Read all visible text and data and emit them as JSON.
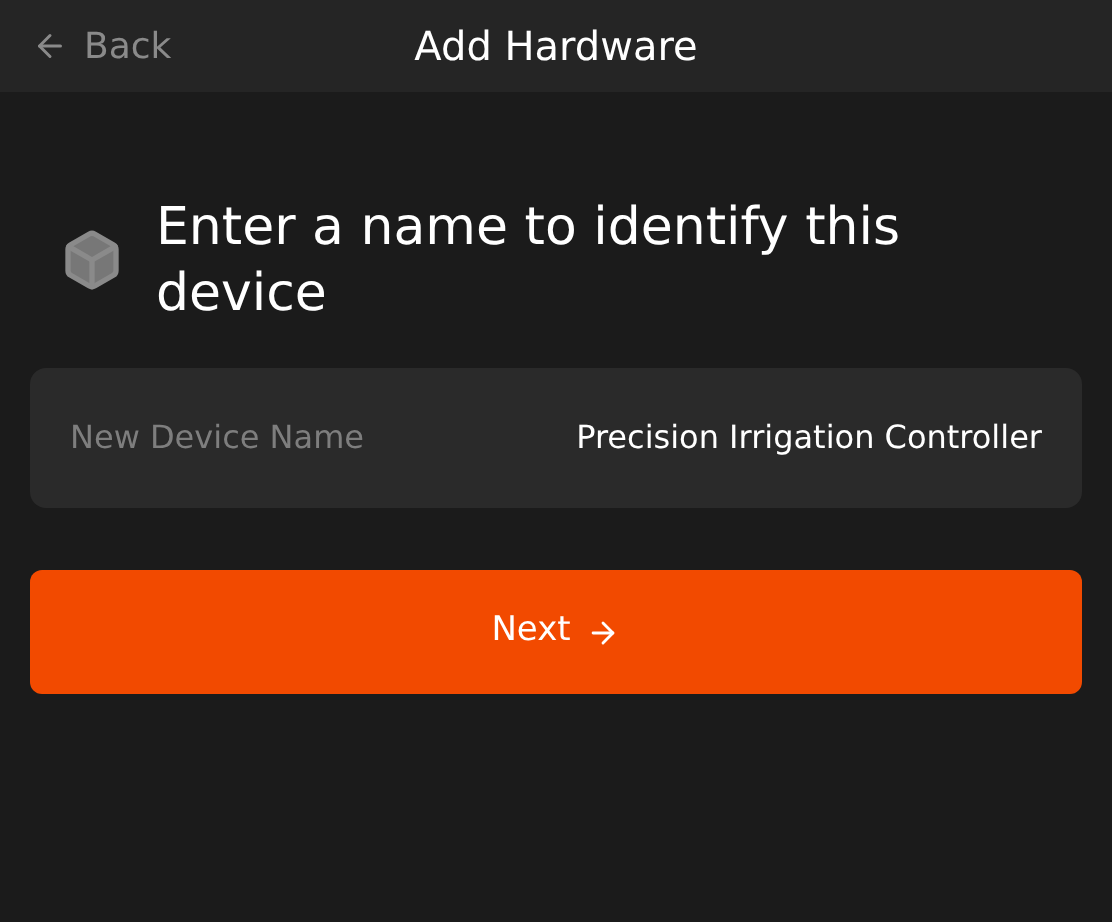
{
  "header": {
    "back": "Back",
    "title": "Add Hardware"
  },
  "prompt": "Enter a name to identify this device",
  "field": {
    "label": "New Device Name",
    "value": "Precision Irrigation Controller"
  },
  "button": {
    "label": "Next"
  }
}
